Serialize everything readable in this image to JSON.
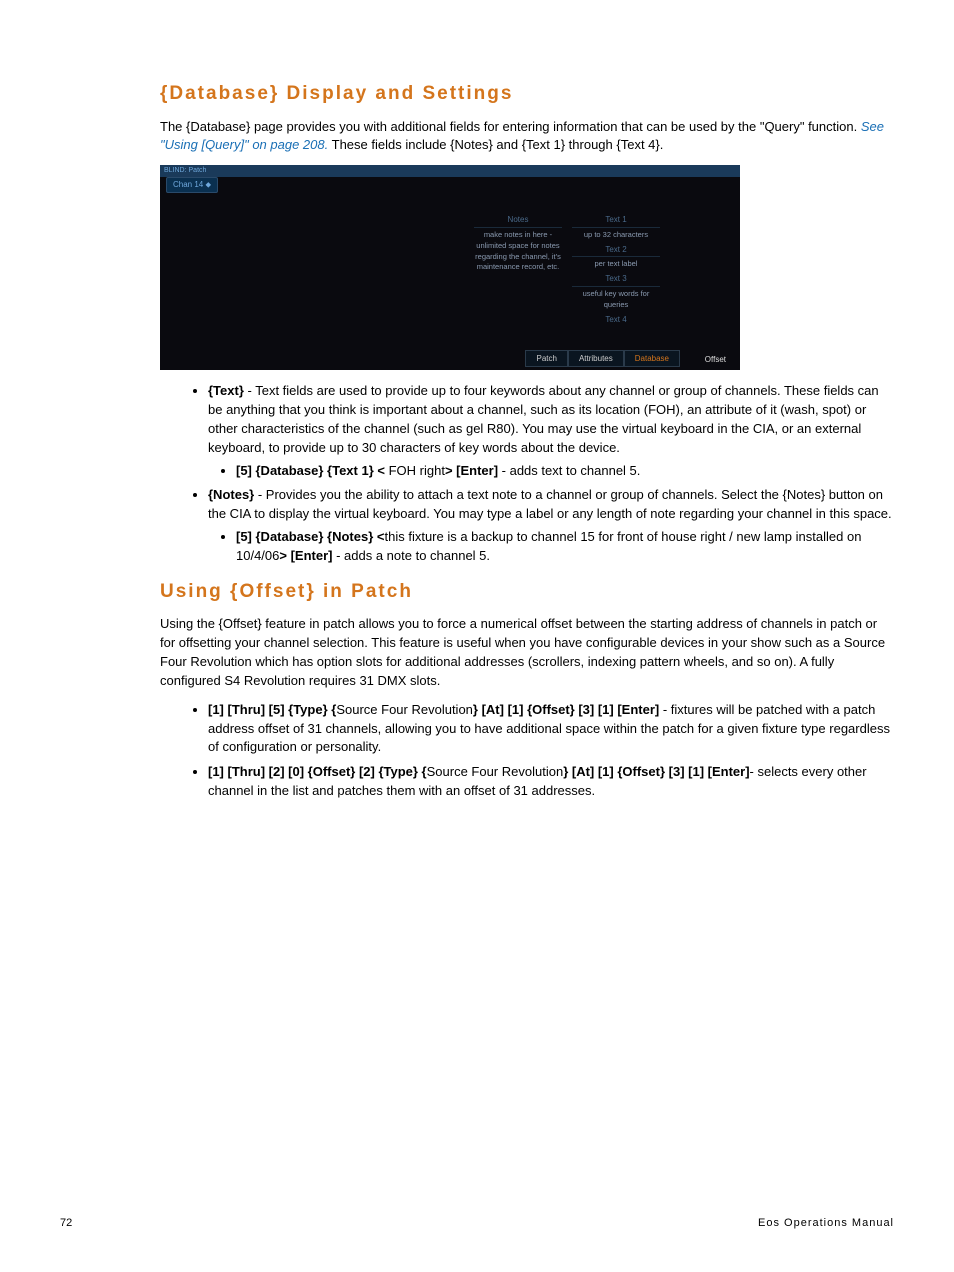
{
  "headings": {
    "h1": "{Database} Display and Settings",
    "h2": "Using {Offset} in Patch"
  },
  "intro": {
    "p1a": "The {Database} page provides you with additional fields for entering information that can be used by the \"Query\" function. ",
    "link1": "See \"Using [Query]\" on page 208.",
    "p1b": " These fields include {Notes} and {Text 1} through {Text 4}."
  },
  "screenshot": {
    "bar": "BLIND: Patch",
    "chip": "Chan 14 ⬥",
    "notes_head": "Notes",
    "notes_cell": "make notes in here - unlimited space for notes regarding the channel, it's maintenance record, etc.",
    "t1h": "Text 1",
    "t1c": "up to 32 characters",
    "t2h": "Text 2",
    "t2c": "per text label",
    "t3h": "Text 3",
    "t3c": "useful key words for queries",
    "t4h": "Text 4",
    "btns": {
      "patch": "Patch",
      "attr": "Attributes",
      "db": "Database",
      "off": "Offset"
    }
  },
  "bullets1": {
    "text_b": "{Text}",
    "text_r": " - Text fields are used to provide up to four keywords about any channel or group of channels. These fields can be anything that you think is important about a channel, such as its location (FOH), an attribute of it (wash, spot) or other characteristics of the channel (such as gel R80). You may use the virtual keyboard in the CIA, or an external keyboard, to provide up to 30 characters of key words about the device.",
    "text_sub_b1": "[5] {Database} {Text 1} < ",
    "text_sub_r1": "FOH right",
    "text_sub_b2": "> [Enter]",
    "text_sub_r2": " - adds text to channel 5.",
    "notes_b": "{Notes}",
    "notes_r": " - Provides you the ability to attach a text note to a channel or group of channels. Select the {Notes} button on the CIA to display the virtual keyboard. You may type a label or any length of note regarding your channel in this space.",
    "notes_sub_b1": "[5] {Database} {Notes} <",
    "notes_sub_r1": "this fixture is a backup to channel 15 for front of house right / new lamp installed on 10/4/06",
    "notes_sub_b2": "> [Enter]",
    "notes_sub_r2": " - adds a note to channel 5."
  },
  "offset": {
    "p": "Using the {Offset} feature in patch allows you to force a numerical offset between the starting address of channels in patch or for offsetting your channel selection. This feature is useful when you have configurable devices in your show such as a Source Four Revolution which has option slots for additional addresses (scrollers, indexing pattern wheels, and so on). A fully configured S4 Revolution requires 31 DMX slots.",
    "li1_b1": "[1] [Thru] [5] {Type} {",
    "li1_r1": "Source Four Revolution",
    "li1_b2": "} [At] [1] {Offset} [3] [1] [Enter]",
    "li1_r2": " - fixtures will be patched with a patch address offset of 31 channels, allowing you to have additional space within the patch for a given fixture type regardless of configuration or personality.",
    "li2_b1": "[1] [Thru] [2] [0] {Offset} [2] {Type} {",
    "li2_r1": "Source Four Revolution",
    "li2_b2": "} [At] [1] {Offset} [3] [1] [Enter]",
    "li2_r2": "- selects every other channel in the list and patches them with an offset of 31 addresses."
  },
  "footer": {
    "page": "72",
    "title": "Eos Operations Manual"
  }
}
